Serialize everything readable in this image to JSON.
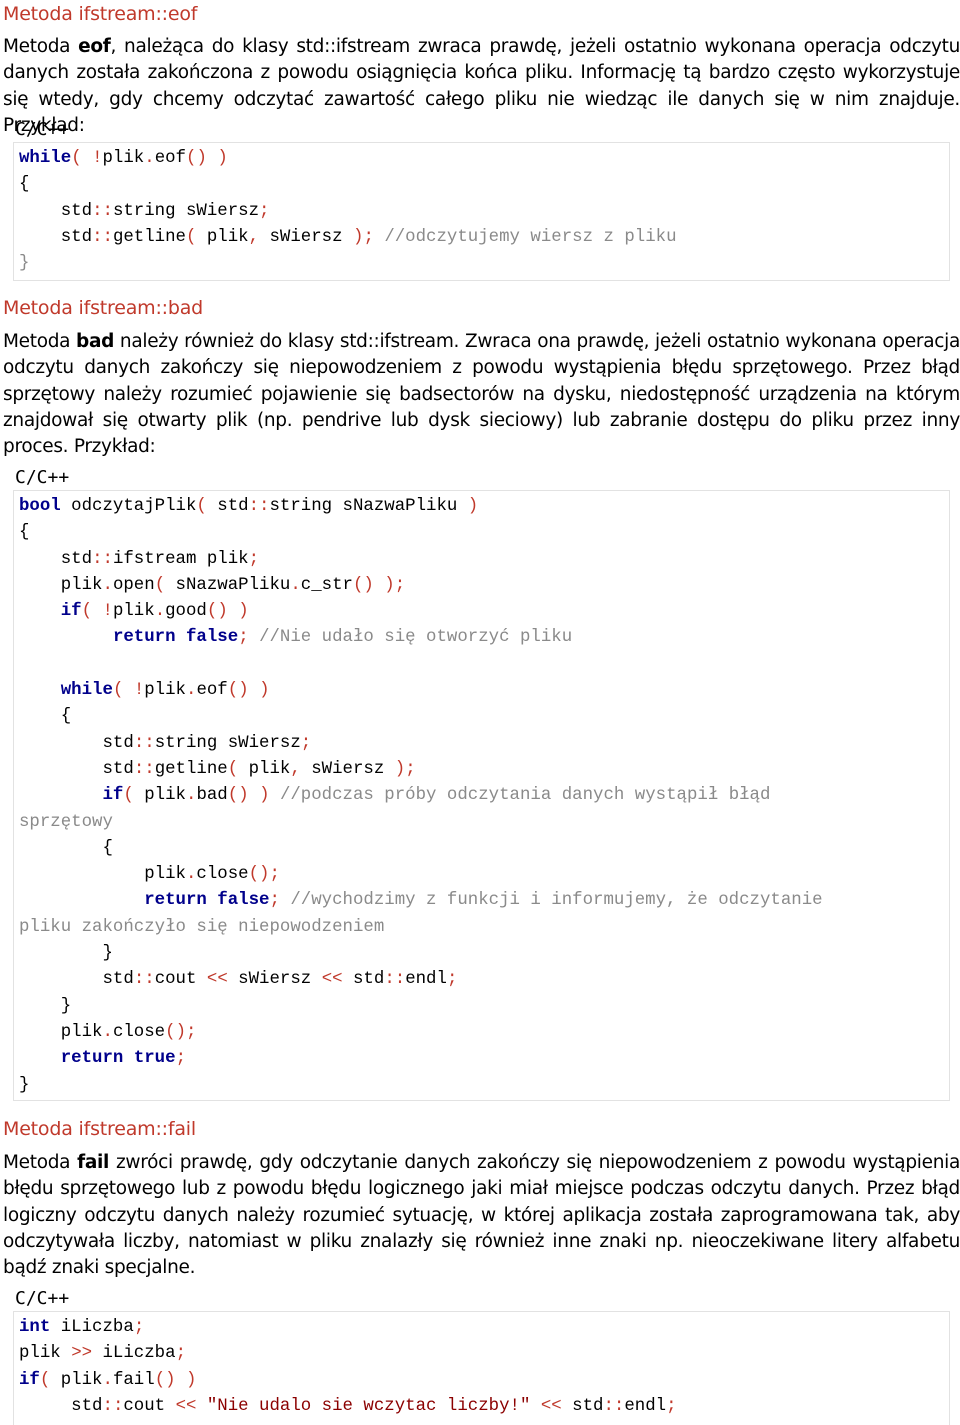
{
  "sections": [
    {
      "title": "Metoda ifstream::eof",
      "para": {
        "pre": "Metoda ",
        "bold": "eof",
        "post": ", należąca do klasy std::ifstream zwraca prawdę, jeżeli ostatnio wykonana operacja odczytu danych została zakończona z powodu osiągnięcia końca pliku. Informację tą bardzo często wykorzystuje się wtedy, gdy chcemy odczytać zawartość całego pliku nie wiedząc ile danych się w nim znajduje. Przykład:"
      },
      "lang": "C/C++",
      "code": [
        "while( !plik.eof() )",
        "{",
        "    std::string sWiersz;",
        "    std::getline( plik, sWiersz ); //odczytujemy wiersz z pliku",
        "}"
      ]
    },
    {
      "title": "Metoda ifstream::bad",
      "para": {
        "pre": "Metoda ",
        "bold": "bad",
        "post": " należy również do klasy std::ifstream. Zwraca ona prawdę, jeżeli ostatnio wykonana operacja odczytu danych zakończy się niepowodzeniem z powodu wystąpienia błędu sprzętowego. Przez błąd sprzętowy należy rozumieć pojawienie się badsectorów na dysku, niedostępność urządzenia na którym znajdował się otwarty plik (np. pendrive lub dysk sieciowy) lub zabranie dostępu do pliku przez inny proces. Przykład:"
      },
      "lang": "C/C++",
      "code": [
        "bool odczytajPlik( std::string sNazwaPliku )",
        "{",
        "    std::ifstream plik;",
        "    plik.open( sNazwaPliku.c_str() );",
        "    if( !plik.good() )",
        "         return false; //Nie udało się otworzyć pliku",
        "",
        "    while( !plik.eof() )",
        "    {",
        "        std::string sWiersz;",
        "        std::getline( plik, sWiersz );",
        "        if( plik.bad() ) //podczas próby odczytania danych wystąpił błąd",
        "sprzętowy",
        "        {",
        "            plik.close();",
        "            return false; //wychodzimy z funkcji i informujemy, że odczytanie",
        "pliku zakończyło się niepowodzeniem",
        "        }",
        "        std::cout << sWiersz << std::endl;",
        "    }",
        "    plik.close();",
        "    return true;",
        "}"
      ]
    },
    {
      "title": "Metoda ifstream::fail",
      "para": {
        "pre": "Metoda ",
        "bold": "fail",
        "post": " zwróci prawdę, gdy odczytanie danych zakończy się niepowodzeniem z powodu wystąpienia błędu sprzętowego lub z powodu błędu logicznego jaki miał miejsce podczas odczytu danych. Przez błąd logiczny odczytu danych należy rozumieć sytuację, w której aplikacja została zaprogramowana tak, aby odczytywała liczby, natomiast w pliku znalazły się również inne znaki np. nieoczekiwane litery alfabetu bądź znaki specjalne."
      },
      "lang": "C/C++",
      "code": [
        "int iLiczba;",
        "plik >> iLiczba;",
        "if( plik.fail() )",
        "     std::cout << \"Nie udalo sie wczytac liczby!\" << std::endl;"
      ]
    }
  ],
  "colors": {
    "heading": "#c0392b",
    "keyword": "#00008b",
    "punct": "#c0392b",
    "comment": "#8a8a8a",
    "string": "#8b0000"
  }
}
